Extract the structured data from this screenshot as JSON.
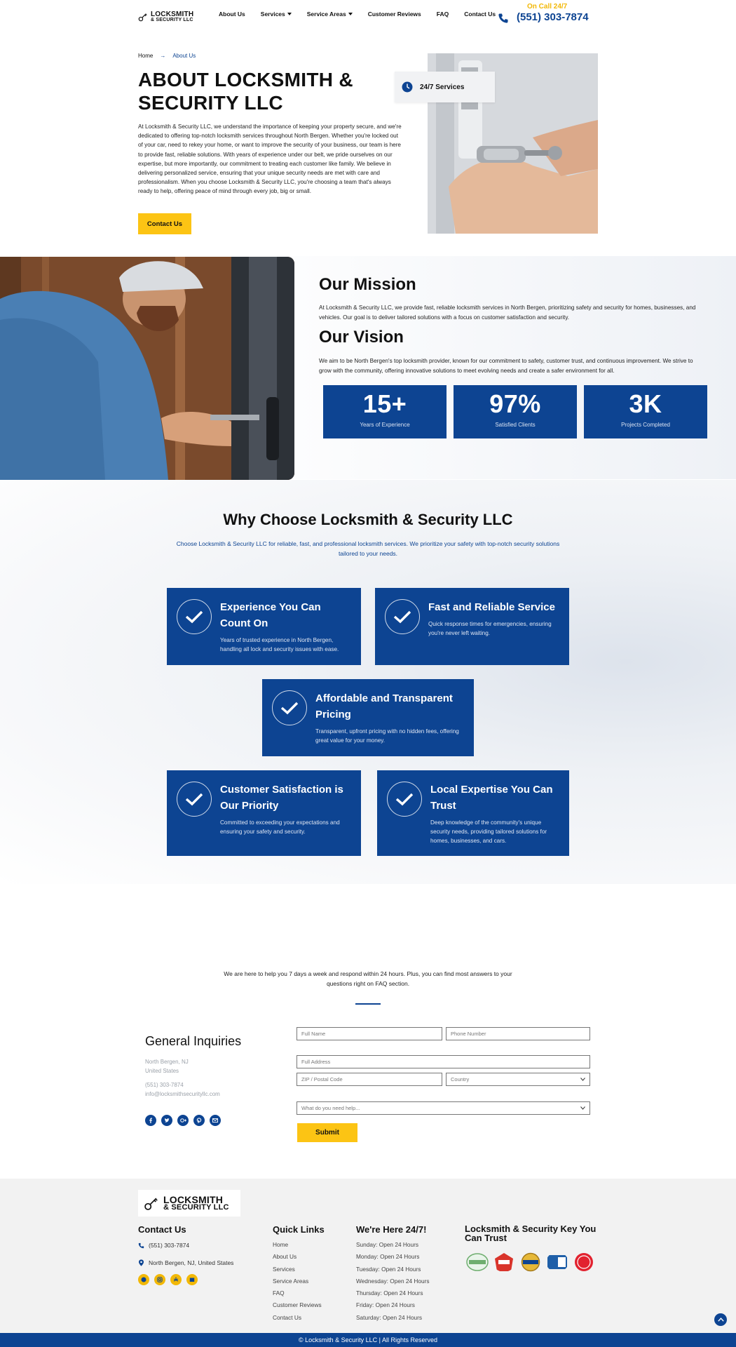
{
  "colors": {
    "brand_blue": "#0d4492",
    "brand_yellow": "#fcc414",
    "footer_bg": "#f2f2f2"
  },
  "header": {
    "logo_line1": "LOCKSMITH",
    "logo_line2": "& SECURITY LLC",
    "nav": [
      "About Us",
      "Services",
      "Service Areas",
      "Customer Reviews",
      "FAQ",
      "Contact Us"
    ],
    "on_call": "On Call 24/7",
    "phone": "(551) 303-7874"
  },
  "hero": {
    "breadcrumb_home": "Home",
    "breadcrumb_arrow": "→",
    "breadcrumb_current": "About Us",
    "title": "ABOUT LOCKSMITH & SECURITY LLC",
    "text": "At Locksmith & Security LLC, we understand the importance of keeping your property secure, and we're dedicated to offering top-notch locksmith services throughout North Bergen. Whether you're locked out of your car, need to rekey your home, or want to improve the security of your business, our team is here to provide fast, reliable solutions. With years of experience under our belt, we pride ourselves on our expertise, but more importantly, our commitment to treating each customer like family. We believe in delivering personalized service, ensuring that your unique security needs are met with care and professionalism. When you choose Locksmith & Security LLC, you're choosing a team that's always ready to help, offering peace of mind through every job, big or small.",
    "button": "Contact Us",
    "badge": "24/7 Services"
  },
  "mission": {
    "title": "Our Mission",
    "text": "At Locksmith & Security LLC, we provide fast, reliable locksmith services in North Bergen, prioritizing safety and security for homes, businesses, and vehicles. Our goal is to deliver tailored solutions with a focus on customer satisfaction and security."
  },
  "vision": {
    "title": "Our Vision",
    "text": "We aim to be North Bergen's top locksmith provider, known for our commitment to safety, customer trust, and continuous improvement. We strive to grow with the community, offering innovative solutions to meet evolving needs and create a safer environment for all."
  },
  "stats": [
    {
      "value": "15+",
      "label": "Years of Experience"
    },
    {
      "value": "97%",
      "label": "Satisfied Clients"
    },
    {
      "value": "3K",
      "label": "Projects Completed"
    }
  ],
  "why": {
    "title": "Why Choose Locksmith & Security LLC",
    "subtitle": "Choose Locksmith & Security LLC for reliable, fast, and professional locksmith services. We prioritize your safety with top-notch security solutions tailored to your needs.",
    "cards": [
      {
        "title": "Experience You Can Count On",
        "text": "Years of trusted experience in North Bergen, handling all lock and security issues with ease."
      },
      {
        "title": "Fast and Reliable Service",
        "text": "Quick response times for emergencies, ensuring you're never left waiting."
      },
      {
        "title": "Affordable and Transparent Pricing",
        "text": "Transparent, upfront pricing with no hidden fees, offering great value for your money."
      },
      {
        "title": "Customer Satisfaction is Our Priority",
        "text": "Committed to exceeding your expectations and ensuring your safety and security."
      },
      {
        "title": "Local Expertise You Can Trust",
        "text": "Deep knowledge of the community's unique security needs, providing tailored solutions for homes, businesses, and cars."
      }
    ]
  },
  "contact": {
    "intro": "We are here to help you 7 days a week and respond within 24 hours. Plus, you can find most answers to your questions right on FAQ section.",
    "heading": "General Inquiries",
    "city": "North Bergen, NJ",
    "country": "United States",
    "phone": "(551) 303-7874",
    "email": "info@locksmithsecurityllc.com",
    "placeholders": {
      "full_name": "Full Name",
      "phone": "Phone Number",
      "address": "Full Address",
      "zip": "ZIP / Postal Code",
      "country": "Country",
      "service": "What do you need help..."
    },
    "submit": "Submit"
  },
  "footer": {
    "contact_title": "Contact Us",
    "phone": "(551) 303-7874",
    "address": "North Bergen, NJ, United States",
    "links_title": "Quick Links",
    "links": [
      "Home",
      "About Us",
      "Services",
      "Service Areas",
      "FAQ",
      "Customer Reviews",
      "Contact Us"
    ],
    "hours_title": "We're Here 24/7!",
    "hours": [
      "Sunday: Open 24 Hours",
      "Monday: Open 24 Hours",
      "Tuesday: Open 24 Hours",
      "Wednesday: Open 24 Hours",
      "Thursday: Open 24 Hours",
      "Friday: Open 24 Hours",
      "Saturday: Open 24 Hours"
    ],
    "trust_title": "Locksmith & Security Key You Can Trust",
    "copyright": "© Locksmith & Security LLC | All Rights Reserved"
  }
}
